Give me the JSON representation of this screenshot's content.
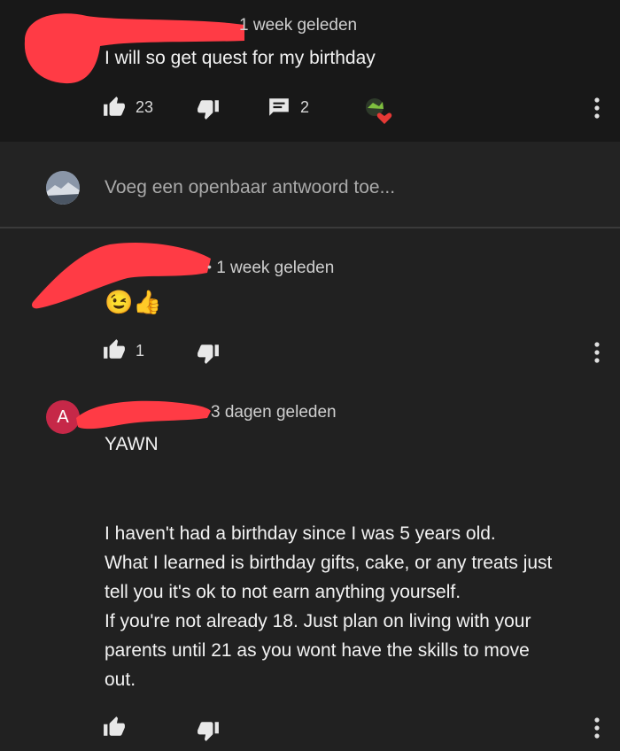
{
  "comment1": {
    "time": "1 week geleden",
    "text": "I will so get quest for my birthday",
    "likes": "23",
    "replies": "2"
  },
  "reply_box": {
    "placeholder": "Voeg een openbaar antwoord toe..."
  },
  "comment2": {
    "time": "1 week geleden",
    "emoji": "😉👍",
    "likes": "1"
  },
  "comment3": {
    "avatar_letter": "A",
    "time": "3 dagen geleden",
    "title": "YAWN",
    "lines": [
      "I haven't had a birthday since I was 5 years old.",
      "What I learned is birthday gifts, cake, or any treats just",
      "tell you it's ok to not earn anything yourself.",
      "If you're not already 18. Just plan on living with your",
      "parents until 21 as you wont have the skills to move",
      "out."
    ]
  },
  "colors": {
    "background": "#212121",
    "redaction": "#ff3b45",
    "avatar_a": "#c62848",
    "heart": "#e53935"
  }
}
